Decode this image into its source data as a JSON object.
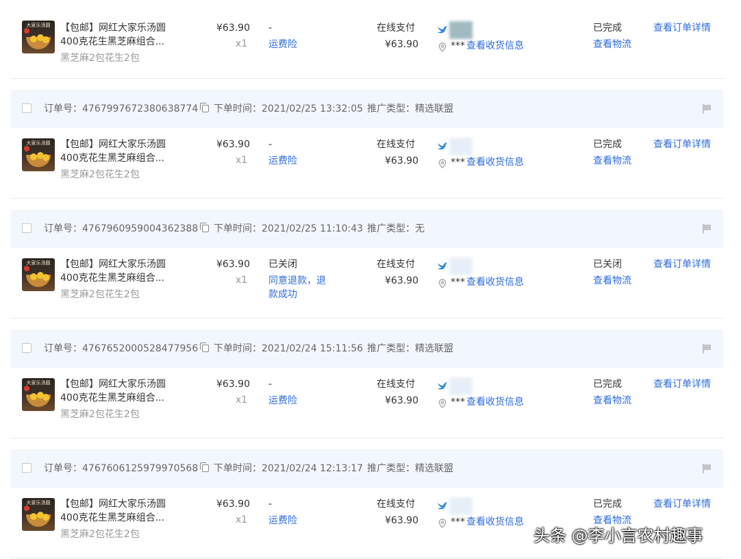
{
  "labels": {
    "order_no_prefix": "订单号：",
    "order_time_prefix": "下单时间：",
    "promo_prefix": "推广类型：",
    "view_receiver": "查看收货信息",
    "view_logistics": "查看物流",
    "view_detail": "查看订单详情",
    "masked": "***"
  },
  "colors": {
    "link": "#2d6cdf",
    "header_bg": "#f2f6fd",
    "muted": "#999999"
  },
  "first_order": {
    "product_line1": "【包邮】网红大家乐汤圆",
    "product_line2": "400克花生黑芝麻组合...",
    "variant": "黑芝麻2包花生2包",
    "price": "¥63.90",
    "quantity": "x1",
    "status_top": "-",
    "status_link": "运费险",
    "pay_method": "在线支付",
    "pay_amount": "¥63.90",
    "order_status": "已完成"
  },
  "orders": [
    {
      "order_no": "4767997672380638774",
      "time": "2021/02/25 13:32:05",
      "promo": "精选联盟",
      "product_line1": "【包邮】网红大家乐汤圆",
      "product_line2": "400克花生黑芝麻组合...",
      "variant": "黑芝麻2包花生2包",
      "price": "¥63.90",
      "quantity": "x1",
      "status_top": "-",
      "status_link": "运费险",
      "status_link2": "",
      "pay_method": "在线支付",
      "pay_amount": "¥63.90",
      "order_status": "已完成"
    },
    {
      "order_no": "4767960959004362388",
      "time": "2021/02/25 11:10:43",
      "promo": "无",
      "product_line1": "【包邮】网红大家乐汤圆",
      "product_line2": "400克花生黑芝麻组合...",
      "variant": "黑芝麻2包花生2包",
      "price": "¥63.90",
      "quantity": "x1",
      "status_top": "已关闭",
      "status_link": "同意退款，退",
      "status_link2": "款成功",
      "pay_method": "在线支付",
      "pay_amount": "¥63.90",
      "order_status": "已关闭"
    },
    {
      "order_no": "4767652000528477956",
      "time": "2021/02/24 15:11:56",
      "promo": "精选联盟",
      "product_line1": "【包邮】网红大家乐汤圆",
      "product_line2": "400克花生黑芝麻组合...",
      "variant": "黑芝麻2包花生2包",
      "price": "¥63.90",
      "quantity": "x1",
      "status_top": "-",
      "status_link": "运费险",
      "status_link2": "",
      "pay_method": "在线支付",
      "pay_amount": "¥63.90",
      "order_status": "已完成"
    },
    {
      "order_no": "4767606125979970568",
      "time": "2021/02/24 12:13:17",
      "promo": "精选联盟",
      "product_line1": "【包邮】网红大家乐汤圆",
      "product_line2": "400克花生黑芝麻组合...",
      "variant": "黑芝麻2包花生2包",
      "price": "¥63.90",
      "quantity": "x1",
      "status_top": "-",
      "status_link": "运费险",
      "status_link2": "",
      "pay_method": "在线支付",
      "pay_amount": "¥63.90",
      "order_status": "已完成"
    }
  ],
  "watermark": "头条 @李小言农村趣事"
}
